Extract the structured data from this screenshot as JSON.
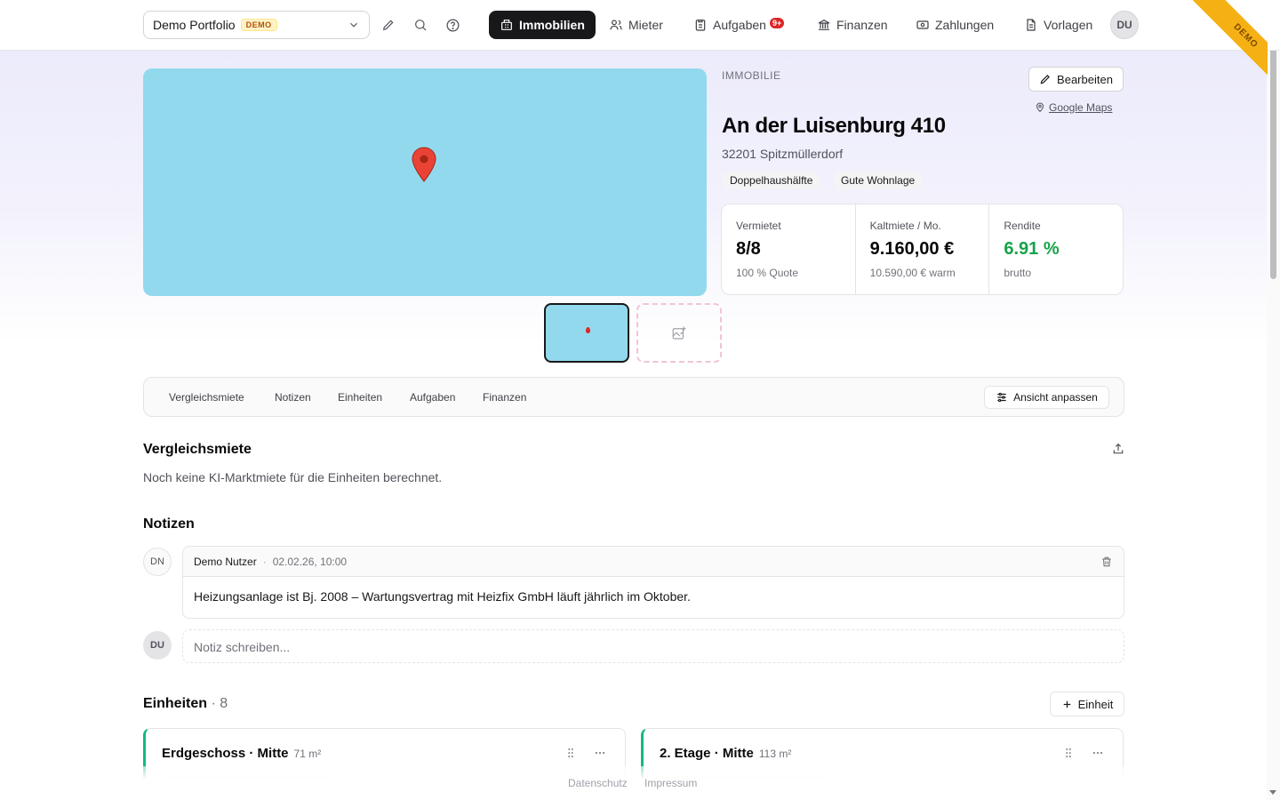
{
  "header": {
    "portfolio_name": "Demo Portfolio",
    "portfolio_badge": "DEMO",
    "nav": [
      {
        "label": "Immobilien",
        "active": true,
        "icon": "building-icon"
      },
      {
        "label": "Mieter",
        "active": false,
        "icon": "users-icon"
      },
      {
        "label": "Aufgaben",
        "active": false,
        "icon": "clipboard-icon",
        "badge": "9+"
      },
      {
        "label": "Finanzen",
        "active": false,
        "icon": "bank-icon"
      },
      {
        "label": "Zahlungen",
        "active": false,
        "icon": "banknote-icon"
      },
      {
        "label": "Vorlagen",
        "active": false,
        "icon": "file-icon"
      }
    ],
    "user_initials": "DU",
    "ribbon": "DEMO"
  },
  "property": {
    "eyebrow": "IMMOBILIE",
    "edit_label": "Bearbeiten",
    "maps_link": "Google Maps",
    "title": "An der Luisenburg 410",
    "address": "32201 Spitzmüllerdorf",
    "tags": [
      "Doppelhaushälfte",
      "Gute Wohnlage"
    ],
    "stats": [
      {
        "label": "Vermietet",
        "value": "8/8",
        "sub": "100 % Quote"
      },
      {
        "label": "Kaltmiete / Mo.",
        "value": "9.160,00 €",
        "sub": "10.590,00 € warm"
      },
      {
        "label": "Rendite",
        "value": "6.91 %",
        "sub": "brutto",
        "color": "#16a34a"
      }
    ]
  },
  "tabs": {
    "items": [
      "Vergleichsmiete",
      "Notizen",
      "Einheiten",
      "Aufgaben",
      "Finanzen"
    ],
    "view_button": "Ansicht anpassen"
  },
  "vergleichsmiete": {
    "title": "Vergleichsmiete",
    "empty_text": "Noch keine KI-Marktmiete für die Einheiten berechnet."
  },
  "notizen": {
    "title": "Notizen",
    "note": {
      "initials": "DN",
      "author": "Demo Nutzer",
      "separator": "·",
      "date": "02.02.26, 10:00",
      "text": "Heizungsanlage ist Bj. 2008 – Wartungsvertrag mit Heizfix GmbH läuft jährlich im Oktober."
    },
    "input_initials": "DU",
    "input_placeholder": "Notiz schreiben..."
  },
  "einheiten": {
    "title": "Einheiten",
    "count": "· 8",
    "add_label": "Einheit",
    "units": [
      {
        "name": "Erdgeschoss · Mitte",
        "size": "71 m²"
      },
      {
        "name": "2. Etage · Mitte",
        "size": "113 m²"
      }
    ]
  },
  "footer": {
    "privacy": "Datenschutz",
    "imprint": "Impressum"
  },
  "colors": {
    "accent": "#18181b",
    "map": "#93d9ee",
    "positive": "#16a34a",
    "unit_status": "#10b981",
    "ribbon": "#f5b014"
  }
}
